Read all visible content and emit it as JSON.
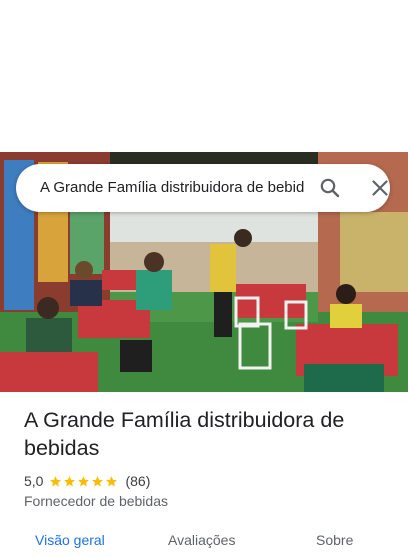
{
  "search": {
    "query": "A Grande Família distribuidora de bebidas"
  },
  "place": {
    "name": "A Grande Família distribuidora de bebidas",
    "rating": "5,0",
    "review_count": "(86)",
    "category": "Fornecedor de bebidas"
  },
  "tabs": [
    {
      "label": "Visão geral",
      "active": true
    },
    {
      "label": "Avaliações",
      "active": false
    },
    {
      "label": "Sobre",
      "active": false
    }
  ],
  "colors": {
    "accent": "#1a73e8",
    "star": "#fbbc04",
    "text_primary": "#202124",
    "text_secondary": "#5f6368"
  },
  "icons": [
    "search-icon",
    "close-icon",
    "star-icon"
  ]
}
